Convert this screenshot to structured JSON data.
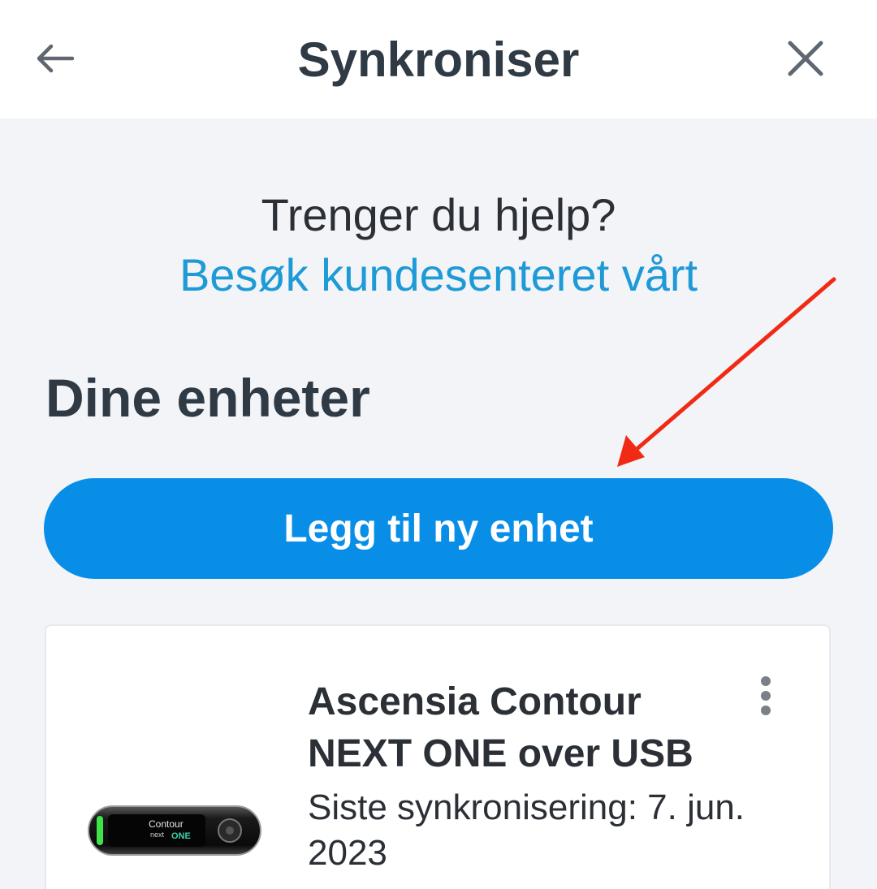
{
  "header": {
    "title": "Synkroniser",
    "back_icon": "arrow-left-icon",
    "close_icon": "close-icon"
  },
  "help": {
    "question": "Trenger du hjelp?",
    "link": "Besøk kundesenteret vårt"
  },
  "devices": {
    "section_title": "Dine enheter",
    "add_button_label": "Legg til ny enhet",
    "items": [
      {
        "name": "Ascensia Contour NEXT ONE over USB",
        "last_sync": "Siste synkronisering: 7. jun. 2023",
        "menu_icon": "more-vertical-icon",
        "image_text": "Contour next ONE"
      }
    ]
  },
  "colors": {
    "accent": "#098ee8",
    "link": "#1e9ad6",
    "annotation_arrow": "#f02a14",
    "background": "#f2f4f8",
    "text_dark": "#2f3a45"
  }
}
